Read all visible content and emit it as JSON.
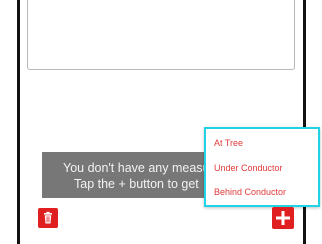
{
  "toast": {
    "line1": "You don't have any measu",
    "line2": "Tap the + button to get"
  },
  "popup_menu": {
    "items": [
      "At Tree",
      "Under Conductor",
      "Behind Conductor"
    ],
    "border_color": "#22d3e6",
    "item_color": "#e03a3a"
  },
  "buttons": {
    "delete_icon": "trash-icon",
    "add_icon": "plus-icon",
    "color": "#e02020"
  }
}
